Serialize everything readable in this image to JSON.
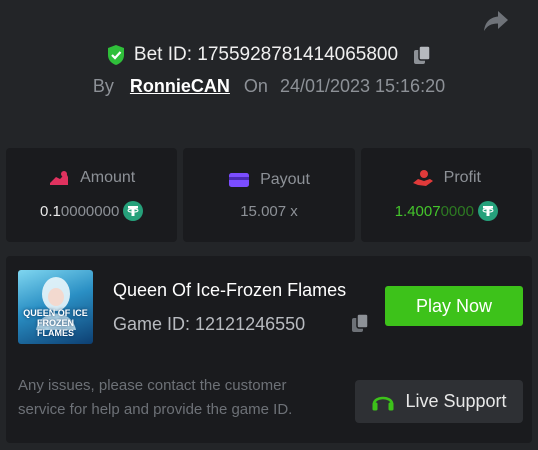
{
  "header": {
    "bet_id_label": "Bet ID: 1755928781414065800",
    "by_label": "By",
    "username": "RonnieCAN",
    "on_label": "On",
    "datetime": "24/01/2023 15:16:20"
  },
  "stats": {
    "amount": {
      "label": "Amount",
      "value_main": "0.1",
      "value_trailing": "0000000"
    },
    "payout": {
      "label": "Payout",
      "value": "15.007 x"
    },
    "profit": {
      "label": "Profit",
      "value_main": "1.4007",
      "value_trailing": "0000"
    }
  },
  "game": {
    "thumb_text_line1": "QUEEN OF ICE",
    "thumb_text_line2": "FROZEN FLAMES",
    "title": "Queen Of Ice-Frozen Flames",
    "id_label": "Game ID: 12121246550",
    "play_label": "Play Now",
    "help_text": "Any issues, please contact the customer service for help and provide the game ID.",
    "support_label": "Live Support"
  },
  "colors": {
    "accent_green": "#3dc21a",
    "profit_green": "#44c52b",
    "amount_icon": "#e0325f",
    "payout_icon": "#7b4dff",
    "profit_icon": "#e03a3a",
    "usdt": "#26a17b"
  },
  "icons": [
    "share-icon",
    "shield-check-icon",
    "copy-icon",
    "amount-icon",
    "payout-icon",
    "profit-icon",
    "usdt-icon",
    "headset-icon"
  ]
}
